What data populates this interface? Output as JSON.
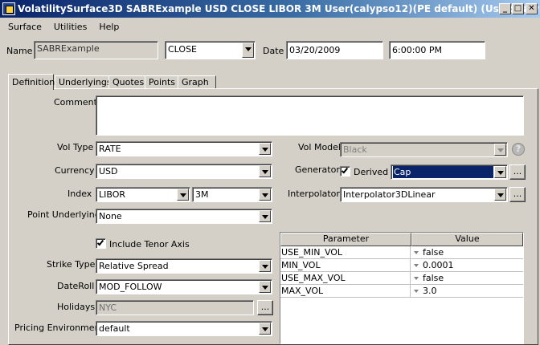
{
  "window": {
    "title": "VolatilitySurface3D SABRExample USD CLOSE LIBOR 3M User(calypso12)(PE default) (User: calypso_user)",
    "minimize": "_",
    "restore": "□",
    "close": "✕"
  },
  "menu": [
    "Surface",
    "Utilities",
    "Help"
  ],
  "header": {
    "name_label": "Name",
    "name_value": "SABRExample",
    "quote_set": "CLOSE",
    "date_label": "Date",
    "date_value": "03/20/2009",
    "time_value": "6:00:00 PM"
  },
  "tabs": [
    "Definition",
    "Underlyings",
    "Quotes",
    "Points",
    "Graph"
  ],
  "definition": {
    "comment_label": "Comment",
    "comment_value": "",
    "vol_type_label": "Vol Type",
    "vol_type_value": "RATE",
    "currency_label": "Currency",
    "currency_value": "USD",
    "index_label": "Index",
    "index_value": "LIBOR",
    "tenor_value": "3M",
    "point_underlying_label": "Point Underlying",
    "point_underlying_value": "None",
    "include_tenor_label": "Include Tenor Axis",
    "include_tenor_checked": true,
    "strike_type_label": "Strike Type",
    "strike_type_value": "Relative Spread",
    "dateroll_label": "DateRoll",
    "dateroll_value": "MOD_FOLLOW",
    "holidays_label": "Holidays",
    "holidays_value": "NYC",
    "pricing_env_label": "Pricing Environment",
    "pricing_env_value": "default",
    "vol_model_label": "Vol Model",
    "vol_model_value": "Black",
    "generator_label": "Generator",
    "derived_label": "Derived",
    "derived_checked": true,
    "generator_value": "Cap",
    "interpolator_label": "Interpolator",
    "interpolator_value": "Interpolator3DLinear",
    "ellipsis": "...",
    "help_glyph": "?"
  },
  "params_table": {
    "columns": [
      "Parameter",
      "Value"
    ],
    "rows": [
      {
        "param": "USE_MIN_VOL",
        "value": "false"
      },
      {
        "param": "MIN_VOL",
        "value": "0.0001"
      },
      {
        "param": "USE_MAX_VOL",
        "value": "false"
      },
      {
        "param": "MAX_VOL",
        "value": "3.0"
      }
    ]
  },
  "colors": {
    "selection": "#0a246a",
    "window_bg": "#d4d0c8"
  }
}
